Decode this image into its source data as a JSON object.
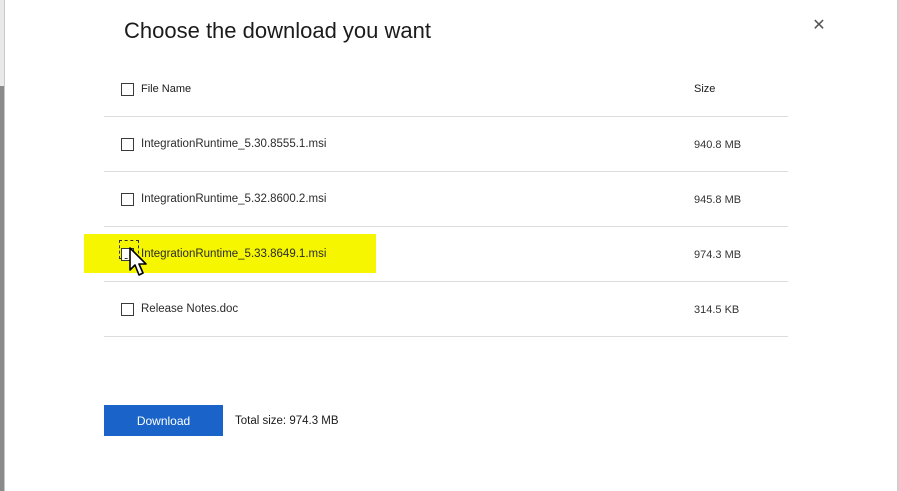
{
  "dialog": {
    "title": "Choose the download you want",
    "close_icon": "close-icon"
  },
  "table": {
    "header": {
      "name": "File Name",
      "size": "Size"
    },
    "rows": [
      {
        "name": "IntegrationRuntime_5.30.8555.1.msi",
        "size": "940.8 MB",
        "checked": false
      },
      {
        "name": "IntegrationRuntime_5.32.8600.2.msi",
        "size": "945.8 MB",
        "checked": false
      },
      {
        "name": "IntegrationRuntime_5.33.8649.1.msi",
        "size": "974.3 MB",
        "checked": false,
        "highlighted": true
      },
      {
        "name": "Release Notes.doc",
        "size": "314.5 KB",
        "checked": false
      }
    ]
  },
  "footer": {
    "download_label": "Download",
    "total_size": "Total size: 974.3 MB"
  },
  "colors": {
    "accent": "#1a64c9",
    "highlight": "#f6f600"
  }
}
